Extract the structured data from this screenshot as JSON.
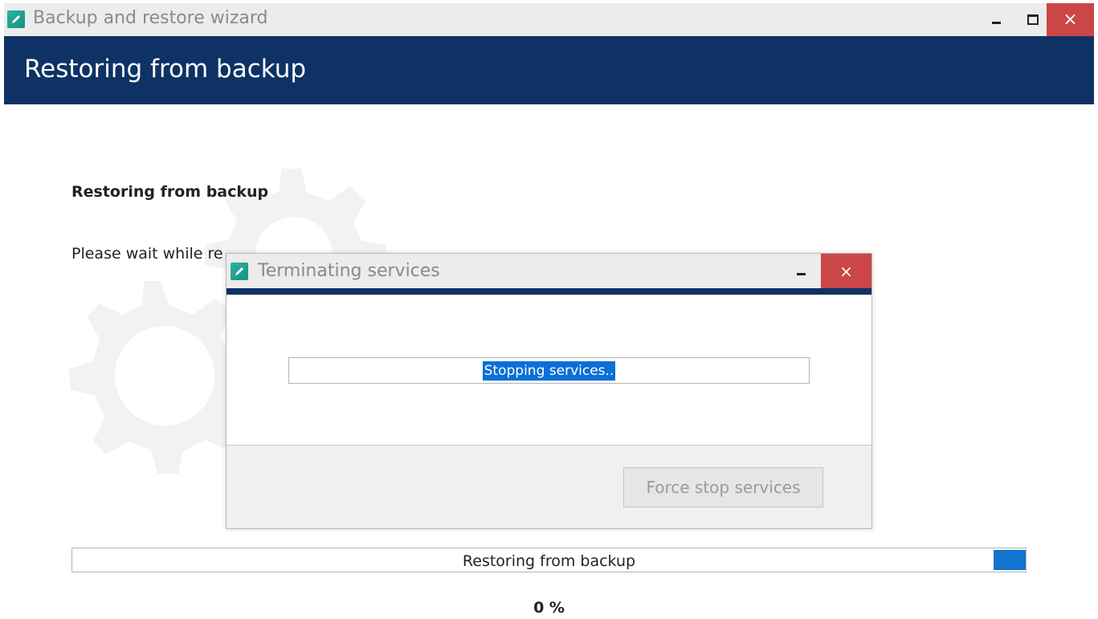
{
  "window": {
    "title": "Backup and restore wizard",
    "icon": "pencil-app-icon",
    "controls": {
      "minimize": "minimize-icon",
      "maximize": "maximize-icon",
      "close": "×"
    }
  },
  "header": {
    "title": "Restoring from backup"
  },
  "content": {
    "heading": "Restoring from backup",
    "wait_text": "Please wait while re"
  },
  "main_progress": {
    "label": "Restoring from backup",
    "percent_text": "0 %",
    "value": 0
  },
  "dialog": {
    "title": "Terminating services",
    "close": "×",
    "progress_text": "Stopping services..",
    "force_stop_label": "Force stop services"
  },
  "colors": {
    "header_band": "#0e3264",
    "close_button": "#cb4646",
    "progress_accent": "#1275cf",
    "selection": "#0a6fd6"
  }
}
